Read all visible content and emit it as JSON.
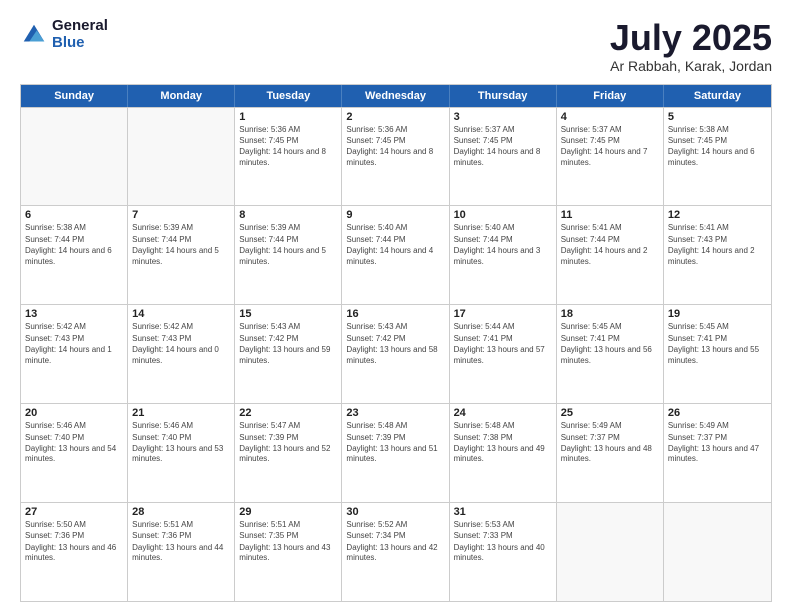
{
  "logo": {
    "general": "General",
    "blue": "Blue"
  },
  "title": "July 2025",
  "subtitle": "Ar Rabbah, Karak, Jordan",
  "header_days": [
    "Sunday",
    "Monday",
    "Tuesday",
    "Wednesday",
    "Thursday",
    "Friday",
    "Saturday"
  ],
  "weeks": [
    [
      {
        "day": "",
        "sunrise": "",
        "sunset": "",
        "daylight": ""
      },
      {
        "day": "",
        "sunrise": "",
        "sunset": "",
        "daylight": ""
      },
      {
        "day": "1",
        "sunrise": "Sunrise: 5:36 AM",
        "sunset": "Sunset: 7:45 PM",
        "daylight": "Daylight: 14 hours and 8 minutes."
      },
      {
        "day": "2",
        "sunrise": "Sunrise: 5:36 AM",
        "sunset": "Sunset: 7:45 PM",
        "daylight": "Daylight: 14 hours and 8 minutes."
      },
      {
        "day": "3",
        "sunrise": "Sunrise: 5:37 AM",
        "sunset": "Sunset: 7:45 PM",
        "daylight": "Daylight: 14 hours and 8 minutes."
      },
      {
        "day": "4",
        "sunrise": "Sunrise: 5:37 AM",
        "sunset": "Sunset: 7:45 PM",
        "daylight": "Daylight: 14 hours and 7 minutes."
      },
      {
        "day": "5",
        "sunrise": "Sunrise: 5:38 AM",
        "sunset": "Sunset: 7:45 PM",
        "daylight": "Daylight: 14 hours and 6 minutes."
      }
    ],
    [
      {
        "day": "6",
        "sunrise": "Sunrise: 5:38 AM",
        "sunset": "Sunset: 7:44 PM",
        "daylight": "Daylight: 14 hours and 6 minutes."
      },
      {
        "day": "7",
        "sunrise": "Sunrise: 5:39 AM",
        "sunset": "Sunset: 7:44 PM",
        "daylight": "Daylight: 14 hours and 5 minutes."
      },
      {
        "day": "8",
        "sunrise": "Sunrise: 5:39 AM",
        "sunset": "Sunset: 7:44 PM",
        "daylight": "Daylight: 14 hours and 5 minutes."
      },
      {
        "day": "9",
        "sunrise": "Sunrise: 5:40 AM",
        "sunset": "Sunset: 7:44 PM",
        "daylight": "Daylight: 14 hours and 4 minutes."
      },
      {
        "day": "10",
        "sunrise": "Sunrise: 5:40 AM",
        "sunset": "Sunset: 7:44 PM",
        "daylight": "Daylight: 14 hours and 3 minutes."
      },
      {
        "day": "11",
        "sunrise": "Sunrise: 5:41 AM",
        "sunset": "Sunset: 7:44 PM",
        "daylight": "Daylight: 14 hours and 2 minutes."
      },
      {
        "day": "12",
        "sunrise": "Sunrise: 5:41 AM",
        "sunset": "Sunset: 7:43 PM",
        "daylight": "Daylight: 14 hours and 2 minutes."
      }
    ],
    [
      {
        "day": "13",
        "sunrise": "Sunrise: 5:42 AM",
        "sunset": "Sunset: 7:43 PM",
        "daylight": "Daylight: 14 hours and 1 minute."
      },
      {
        "day": "14",
        "sunrise": "Sunrise: 5:42 AM",
        "sunset": "Sunset: 7:43 PM",
        "daylight": "Daylight: 14 hours and 0 minutes."
      },
      {
        "day": "15",
        "sunrise": "Sunrise: 5:43 AM",
        "sunset": "Sunset: 7:42 PM",
        "daylight": "Daylight: 13 hours and 59 minutes."
      },
      {
        "day": "16",
        "sunrise": "Sunrise: 5:43 AM",
        "sunset": "Sunset: 7:42 PM",
        "daylight": "Daylight: 13 hours and 58 minutes."
      },
      {
        "day": "17",
        "sunrise": "Sunrise: 5:44 AM",
        "sunset": "Sunset: 7:41 PM",
        "daylight": "Daylight: 13 hours and 57 minutes."
      },
      {
        "day": "18",
        "sunrise": "Sunrise: 5:45 AM",
        "sunset": "Sunset: 7:41 PM",
        "daylight": "Daylight: 13 hours and 56 minutes."
      },
      {
        "day": "19",
        "sunrise": "Sunrise: 5:45 AM",
        "sunset": "Sunset: 7:41 PM",
        "daylight": "Daylight: 13 hours and 55 minutes."
      }
    ],
    [
      {
        "day": "20",
        "sunrise": "Sunrise: 5:46 AM",
        "sunset": "Sunset: 7:40 PM",
        "daylight": "Daylight: 13 hours and 54 minutes."
      },
      {
        "day": "21",
        "sunrise": "Sunrise: 5:46 AM",
        "sunset": "Sunset: 7:40 PM",
        "daylight": "Daylight: 13 hours and 53 minutes."
      },
      {
        "day": "22",
        "sunrise": "Sunrise: 5:47 AM",
        "sunset": "Sunset: 7:39 PM",
        "daylight": "Daylight: 13 hours and 52 minutes."
      },
      {
        "day": "23",
        "sunrise": "Sunrise: 5:48 AM",
        "sunset": "Sunset: 7:39 PM",
        "daylight": "Daylight: 13 hours and 51 minutes."
      },
      {
        "day": "24",
        "sunrise": "Sunrise: 5:48 AM",
        "sunset": "Sunset: 7:38 PM",
        "daylight": "Daylight: 13 hours and 49 minutes."
      },
      {
        "day": "25",
        "sunrise": "Sunrise: 5:49 AM",
        "sunset": "Sunset: 7:37 PM",
        "daylight": "Daylight: 13 hours and 48 minutes."
      },
      {
        "day": "26",
        "sunrise": "Sunrise: 5:49 AM",
        "sunset": "Sunset: 7:37 PM",
        "daylight": "Daylight: 13 hours and 47 minutes."
      }
    ],
    [
      {
        "day": "27",
        "sunrise": "Sunrise: 5:50 AM",
        "sunset": "Sunset: 7:36 PM",
        "daylight": "Daylight: 13 hours and 46 minutes."
      },
      {
        "day": "28",
        "sunrise": "Sunrise: 5:51 AM",
        "sunset": "Sunset: 7:36 PM",
        "daylight": "Daylight: 13 hours and 44 minutes."
      },
      {
        "day": "29",
        "sunrise": "Sunrise: 5:51 AM",
        "sunset": "Sunset: 7:35 PM",
        "daylight": "Daylight: 13 hours and 43 minutes."
      },
      {
        "day": "30",
        "sunrise": "Sunrise: 5:52 AM",
        "sunset": "Sunset: 7:34 PM",
        "daylight": "Daylight: 13 hours and 42 minutes."
      },
      {
        "day": "31",
        "sunrise": "Sunrise: 5:53 AM",
        "sunset": "Sunset: 7:33 PM",
        "daylight": "Daylight: 13 hours and 40 minutes."
      },
      {
        "day": "",
        "sunrise": "",
        "sunset": "",
        "daylight": ""
      },
      {
        "day": "",
        "sunrise": "",
        "sunset": "",
        "daylight": ""
      }
    ]
  ]
}
